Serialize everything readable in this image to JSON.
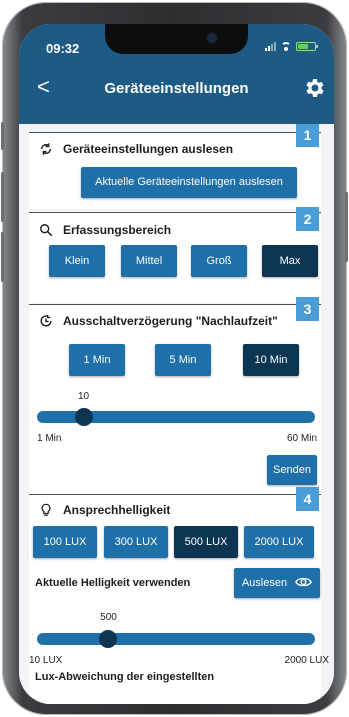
{
  "status": {
    "time": "09:32"
  },
  "header": {
    "title": "Geräteeinstellungen",
    "back_glyph": "<"
  },
  "sections": [
    {
      "badge": "1",
      "title": "Geräteeinstellungen auslesen",
      "icon": "refresh-icon",
      "button": "Aktuelle Geräteeinstellungen auslesen"
    },
    {
      "badge": "2",
      "title": "Erfassungsbereich",
      "icon": "search-icon",
      "options": [
        "Klein",
        "Mittel",
        "Groß",
        "Max"
      ],
      "selected": "Max"
    },
    {
      "badge": "3",
      "title": "Ausschaltverzögerung \"Nachlaufzeit\"",
      "icon": "timer-icon",
      "options": [
        "1 Min",
        "5 Min",
        "10 Min"
      ],
      "selected": "10 Min",
      "slider": {
        "value": "10",
        "min_label": "1 Min",
        "max_label": "60 Min",
        "min": 1,
        "max": 60,
        "current": 10
      },
      "send": "Senden"
    },
    {
      "badge": "4",
      "title": "Ansprechhelligkeit",
      "icon": "lightbulb-icon",
      "options": [
        "100 LUX",
        "300 LUX",
        "500 LUX",
        "2000 LUX"
      ],
      "selected": "500 LUX",
      "current_label": "Aktuelle Helligkeit verwenden",
      "read_button": "Auslesen",
      "slider": {
        "value": "500",
        "min_label": "10 LUX",
        "max_label": "2000 LUX",
        "min": 10,
        "max": 2000,
        "current": 500
      },
      "cut_text": "Lux-Abweichung der eingestellten"
    }
  ],
  "colors": {
    "primary": "#1f6fa8",
    "selected": "#0c3552",
    "header": "#1d5b85",
    "badge": "#4a9ed8"
  }
}
